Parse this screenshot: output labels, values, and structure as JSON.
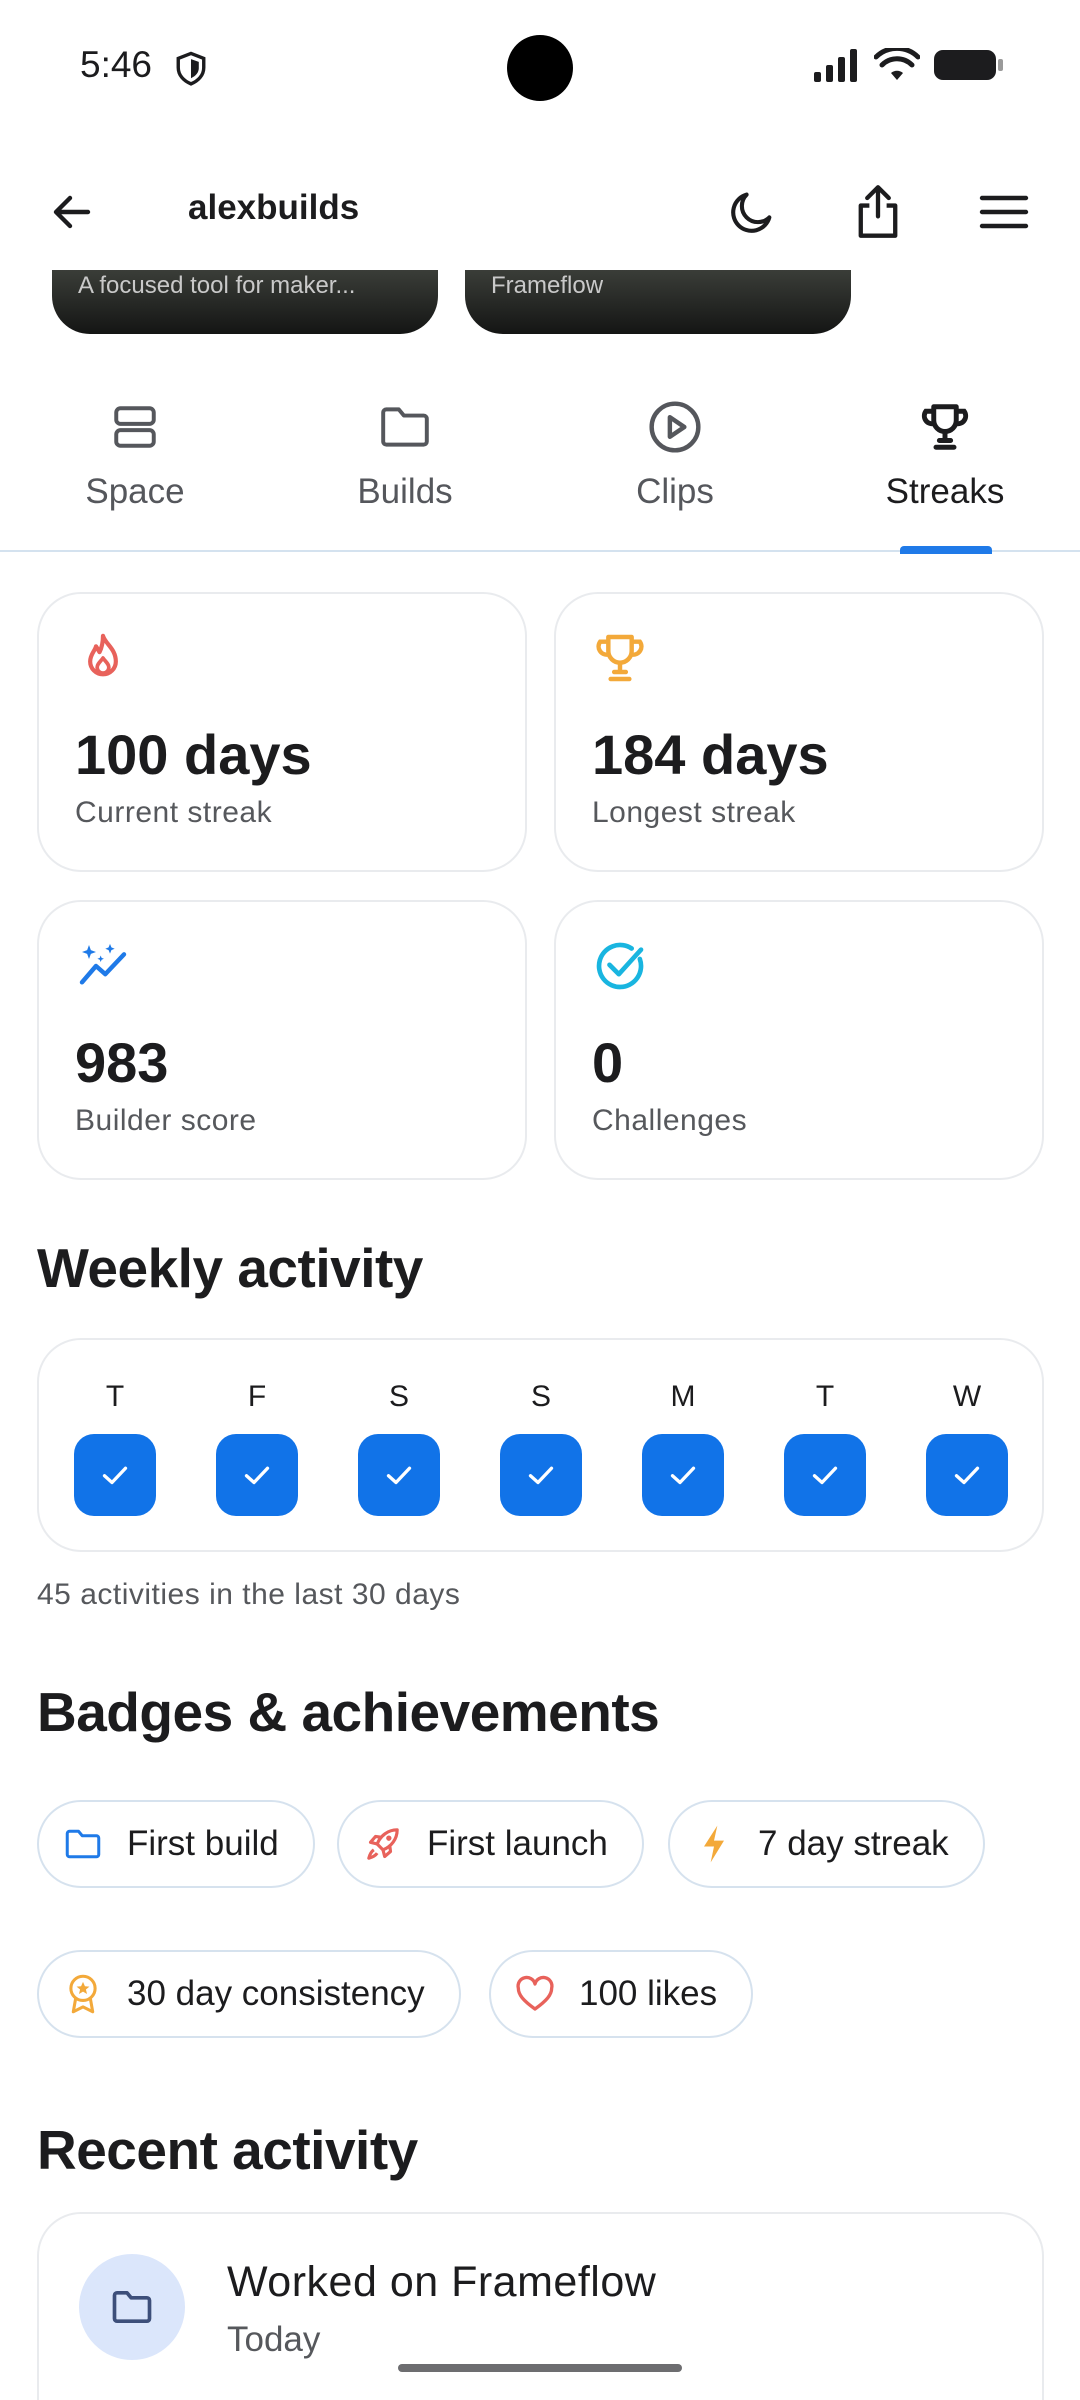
{
  "status_bar": {
    "time": "5:46"
  },
  "header": {
    "title": "alexbuilds"
  },
  "covers": [
    {
      "caption": "A focused tool for maker..."
    },
    {
      "caption": "Frameflow"
    }
  ],
  "tabs": [
    {
      "label": "Space",
      "icon": "space-icon"
    },
    {
      "label": "Builds",
      "icon": "folder-icon"
    },
    {
      "label": "Clips",
      "icon": "play-circle-icon"
    },
    {
      "label": "Streaks",
      "icon": "trophy-icon",
      "active": true
    }
  ],
  "stats": [
    {
      "value": "100 days",
      "label": "Current streak",
      "icon": "flame-icon",
      "color": "#e8625b"
    },
    {
      "value": "184 days",
      "label": "Longest streak",
      "icon": "trophy-icon",
      "color": "#f3a93a"
    },
    {
      "value": "983",
      "label": "Builder score",
      "icon": "sparkle-chart-icon",
      "color": "#1f7ae8"
    },
    {
      "value": "0",
      "label": "Challenges",
      "icon": "check-circle-icon",
      "color": "#19b5e0"
    }
  ],
  "weekly": {
    "title": "Weekly activity",
    "days": [
      {
        "letter": "T",
        "done": true
      },
      {
        "letter": "F",
        "done": true
      },
      {
        "letter": "S",
        "done": true
      },
      {
        "letter": "S",
        "done": true
      },
      {
        "letter": "M",
        "done": true
      },
      {
        "letter": "T",
        "done": true
      },
      {
        "letter": "W",
        "done": true
      }
    ],
    "summary": "45 activities in the last 30 days"
  },
  "badges": {
    "title": "Badges & achievements",
    "items": [
      {
        "label": "First build",
        "icon": "folder-icon",
        "color": "#1f7ae8"
      },
      {
        "label": "First launch",
        "icon": "rocket-icon",
        "color": "#e8625b"
      },
      {
        "label": "7 day streak",
        "icon": "lightning-icon",
        "color": "#f3a93a"
      },
      {
        "label": "30 day consistency",
        "icon": "medal-icon",
        "color": "#f3a93a"
      },
      {
        "label": "100 likes",
        "icon": "heart-icon",
        "color": "#e8625b"
      }
    ]
  },
  "recent": {
    "title": "Recent activity",
    "items": [
      {
        "title": "Worked on Frameflow",
        "time": "Today",
        "icon": "folder-icon"
      }
    ]
  },
  "colors": {
    "accent": "#1f7ae8",
    "check_fill": "#1173e8",
    "card_border": "#e9ebee",
    "pill_border": "#d6e2ee"
  }
}
